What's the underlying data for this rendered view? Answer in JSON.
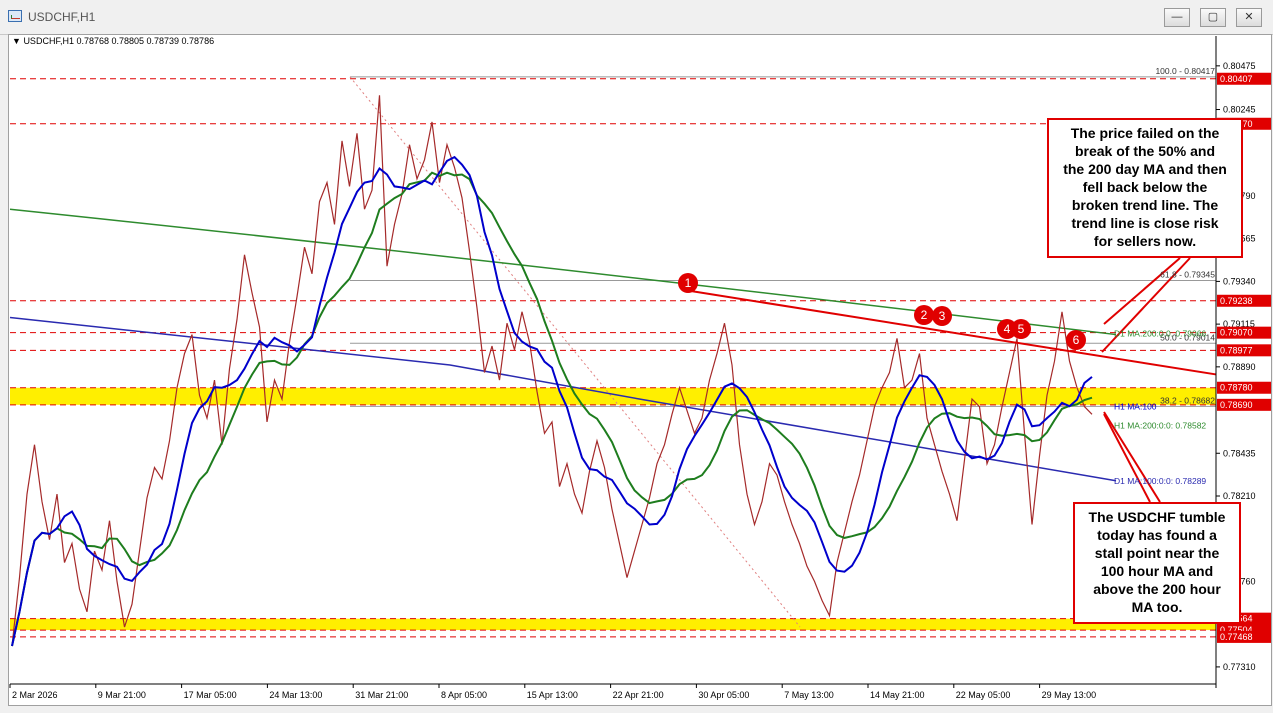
{
  "window": {
    "title": "USDCHF,H1",
    "buttons": {
      "minimize": "—",
      "restore": "▢",
      "close": "✕"
    }
  },
  "symbol_info": "USDCHF,H1  0.78768 0.78805 0.78739 0.78786",
  "colors": {
    "price_line": "#a52a2a",
    "ma100": "#0000cc",
    "ma200_h1": "#1e7d1e",
    "ma200_d1": "#2e8b2e",
    "ma100_d1": "#2a2ab0",
    "red": "#e00000",
    "zone": "#ffef00"
  },
  "chart_data": {
    "type": "line",
    "x_ticks": [
      "2 Mar 2026",
      "9 Mar 21:00",
      "17 Mar 05:00",
      "24 Mar 13:00",
      "31 Mar 21:00",
      "8 Apr 05:00",
      "15 Apr 13:00",
      "22 Apr 21:00",
      "30 Apr 05:00",
      "7 May 13:00",
      "14 May 21:00",
      "22 May 05:00",
      "29 May 13:00"
    ],
    "y_ticks": [
      {
        "label": "0.80475",
        "value": 0.80475
      },
      {
        "label": "0.80245",
        "value": 0.80245
      },
      {
        "label": "0.79790",
        "value": 0.7979
      },
      {
        "label": "0.79565",
        "value": 0.79565
      },
      {
        "label": "0.79340",
        "value": 0.7934
      },
      {
        "label": "0.79115",
        "value": 0.79115
      },
      {
        "label": "0.78890",
        "value": 0.7889
      },
      {
        "label": "0.78435",
        "value": 0.78435
      },
      {
        "label": "0.78210",
        "value": 0.7821
      },
      {
        "label": "0.77760",
        "value": 0.7776
      },
      {
        "label": "0.77310",
        "value": 0.7731
      }
    ],
    "ylim": [
      0.7722,
      0.8059
    ],
    "price_levels": [
      {
        "label": "0.80407",
        "value": 0.80407
      },
      {
        "label": "0.80170",
        "value": 0.8017
      },
      {
        "label": "0.79238",
        "value": 0.79238
      },
      {
        "label": "0.79070",
        "value": 0.7907
      },
      {
        "label": "0.78977",
        "value": 0.78977
      },
      {
        "label": "0.78780",
        "value": 0.7878
      },
      {
        "label": "0.78690",
        "value": 0.7869
      },
      {
        "label": "0.77564",
        "value": 0.77564
      },
      {
        "label": "0.77504",
        "value": 0.77504
      },
      {
        "label": "0.77468",
        "value": 0.77468
      }
    ],
    "zones": [
      {
        "from": 0.7869,
        "to": 0.7878
      },
      {
        "from": 0.77504,
        "to": 0.77564
      }
    ],
    "fib_labels": [
      {
        "text": "100.0 - 0.80417",
        "value": 0.80417
      },
      {
        "text": "61.8 - 0.79345",
        "value": 0.79345
      },
      {
        "text": "50.0 - 0.79014",
        "value": 0.79014
      },
      {
        "text": "38.2 - 0.78682",
        "value": 0.78682
      }
    ],
    "ma_labels": [
      {
        "text": "D1 MA:200:0:0: 0.79066",
        "value": 0.79066
      },
      {
        "text": "H1 MA:100",
        "value": 0.78682
      },
      {
        "text": "H1 MA:200:0:0: 0.78582",
        "value": 0.78582
      },
      {
        "text": "D1 MA:100:0:0: 0.78289",
        "value": 0.78289
      }
    ],
    "close": [
      0.7742,
      0.7778,
      0.7822,
      0.7848,
      0.7818,
      0.7798,
      0.7822,
      0.7786,
      0.7796,
      0.7772,
      0.776,
      0.7792,
      0.7782,
      0.7808,
      0.7776,
      0.7752,
      0.7764,
      0.7792,
      0.782,
      0.7836,
      0.783,
      0.785,
      0.7878,
      0.7896,
      0.7906,
      0.7874,
      0.7862,
      0.7882,
      0.7848,
      0.7888,
      0.7914,
      0.7948,
      0.7928,
      0.791,
      0.786,
      0.7882,
      0.7872,
      0.7902,
      0.7926,
      0.7952,
      0.7938,
      0.7976,
      0.7986,
      0.7964,
      0.8008,
      0.7984,
      0.8012,
      0.7972,
      0.7982,
      0.8032,
      0.7942,
      0.7964,
      0.798,
      0.8006,
      0.7988,
      0.7998,
      0.8018,
      0.7986,
      0.8006,
      0.7994,
      0.7978,
      0.795,
      0.792,
      0.7886,
      0.79,
      0.7882,
      0.7912,
      0.7898,
      0.7918,
      0.7902,
      0.7876,
      0.7854,
      0.786,
      0.7826,
      0.7838,
      0.7822,
      0.7812,
      0.7834,
      0.785,
      0.7836,
      0.7814,
      0.7796,
      0.7778,
      0.7792,
      0.7806,
      0.782,
      0.7838,
      0.7848,
      0.7864,
      0.7878,
      0.7866,
      0.7854,
      0.7862,
      0.7882,
      0.7896,
      0.7912,
      0.789,
      0.7848,
      0.7822,
      0.7806,
      0.7818,
      0.7838,
      0.7832,
      0.7818,
      0.7806,
      0.7796,
      0.7784,
      0.7776,
      0.7766,
      0.7758,
      0.7786,
      0.7802,
      0.7818,
      0.7832,
      0.785,
      0.7868,
      0.7878,
      0.7886,
      0.7904,
      0.7878,
      0.7882,
      0.7896,
      0.7862,
      0.7848,
      0.7834,
      0.7822,
      0.7808,
      0.784,
      0.7872,
      0.7868,
      0.7838,
      0.7848,
      0.7868,
      0.7886,
      0.7904,
      0.7854,
      0.7806,
      0.7842,
      0.7874,
      0.7892,
      0.7918,
      0.7892,
      0.7878,
      0.7868,
      0.7864
    ]
  },
  "markers": [
    "1",
    "2",
    "3",
    "4",
    "5",
    "6"
  ],
  "annotations": {
    "top": [
      "The price failed on the",
      "break of the 50% and",
      "the 200 day MA and then",
      "fell back below the",
      "broken trend line.  The",
      "trend line is close risk",
      "for sellers now."
    ],
    "bottom": [
      "The USDCHF tumble",
      "today has found a",
      "stall point near the",
      "100 hour MA and",
      "above the 200 hour",
      "MA too."
    ]
  }
}
